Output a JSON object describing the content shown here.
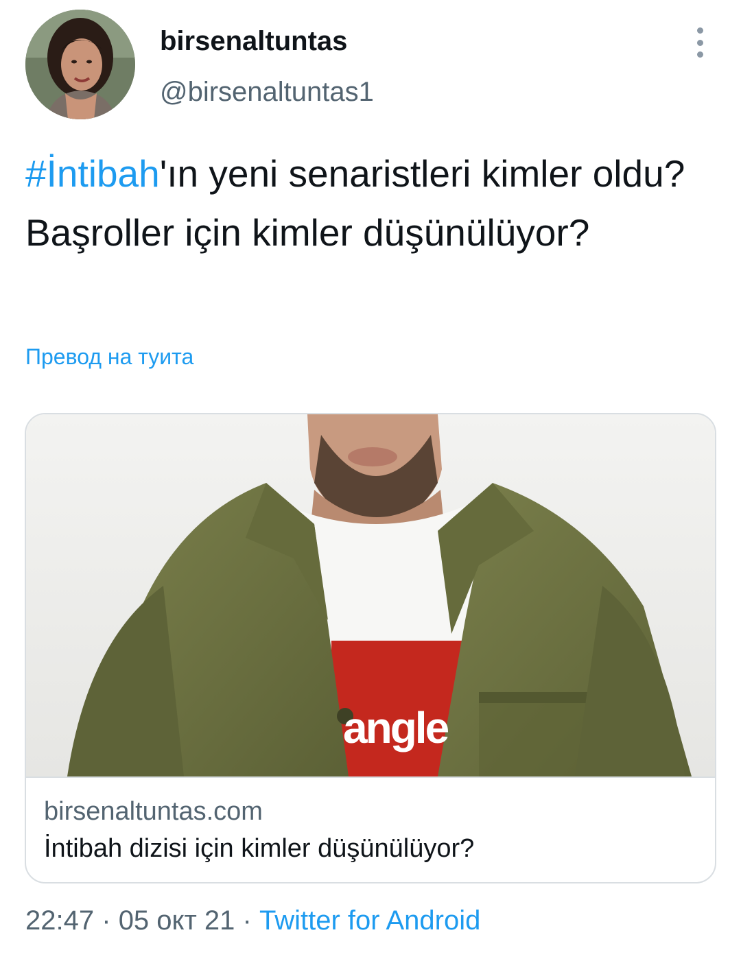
{
  "author": {
    "display_name": "birsenaltuntas",
    "handle": "@birsenaltuntas1"
  },
  "tweet": {
    "hashtag": "#İntibah",
    "text_after_hashtag": "'ın yeni senaristleri kimler oldu? Başroller için kimler düşünülüyor?",
    "translate_label": "Превод на туита"
  },
  "link_card": {
    "domain": "birsenaltuntas.com",
    "title": "İntibah dizisi için kimler düşünülüyor?",
    "image_logo_text": "angle"
  },
  "meta": {
    "time": "22:47",
    "separator": "·",
    "date": "05 окт 21",
    "source": "Twitter for Android"
  },
  "icons": {
    "more": "more-vertical-icon"
  },
  "colors": {
    "link": "#1d9bf0",
    "text": "#0f1419",
    "secondary": "#536471",
    "border": "#d9dee2",
    "jacket": "#6b7040"
  }
}
